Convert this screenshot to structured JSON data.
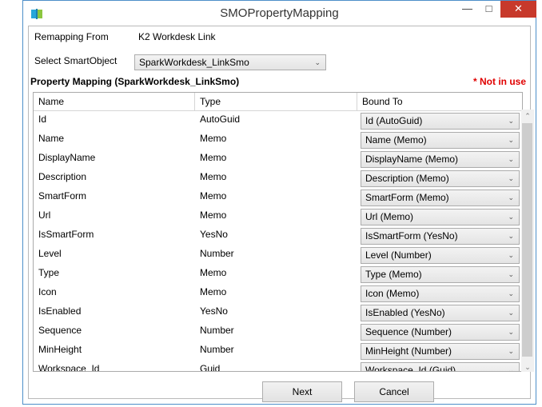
{
  "window": {
    "title": "SMOPropertyMapping"
  },
  "remapping": {
    "label": "Remapping From",
    "value": "K2 Workdesk Link"
  },
  "smartobject": {
    "label": "Select SmartObject",
    "selected": "SparkWorkdesk_LinkSmo"
  },
  "mapping": {
    "title": "Property Mapping (SparkWorkdesk_LinkSmo)",
    "not_in_use": "* Not in use"
  },
  "grid": {
    "columns": [
      "Name",
      "Type",
      "Bound To"
    ],
    "rows": [
      {
        "name": "Id",
        "type": "AutoGuid",
        "bound": "Id (AutoGuid)"
      },
      {
        "name": "Name",
        "type": "Memo",
        "bound": "Name (Memo)"
      },
      {
        "name": "DisplayName",
        "type": "Memo",
        "bound": "DisplayName (Memo)"
      },
      {
        "name": "Description",
        "type": "Memo",
        "bound": "Description (Memo)"
      },
      {
        "name": "SmartForm",
        "type": "Memo",
        "bound": "SmartForm (Memo)"
      },
      {
        "name": "Url",
        "type": "Memo",
        "bound": "Url (Memo)"
      },
      {
        "name": "IsSmartForm",
        "type": "YesNo",
        "bound": "IsSmartForm (YesNo)"
      },
      {
        "name": "Level",
        "type": "Number",
        "bound": "Level (Number)"
      },
      {
        "name": "Type",
        "type": "Memo",
        "bound": "Type (Memo)"
      },
      {
        "name": "Icon",
        "type": "Memo",
        "bound": "Icon (Memo)"
      },
      {
        "name": "IsEnabled",
        "type": "YesNo",
        "bound": "IsEnabled (YesNo)"
      },
      {
        "name": "Sequence",
        "type": "Number",
        "bound": "Sequence (Number)"
      },
      {
        "name": "MinHeight",
        "type": "Number",
        "bound": "MinHeight (Number)"
      },
      {
        "name": "Workspace_Id",
        "type": "Guid",
        "bound": "Workspace_Id (Guid)"
      }
    ]
  },
  "buttons": {
    "next": "Next",
    "cancel": "Cancel"
  },
  "icons": {
    "app": "k2-book-icon",
    "minimize": "minimize-icon",
    "maximize": "maximize-icon",
    "close": "close-icon",
    "dropdown": "chevron-down-icon"
  },
  "colors": {
    "close": "#c7392b",
    "not_in_use": "#e00000",
    "border": "#4d8fc9"
  }
}
